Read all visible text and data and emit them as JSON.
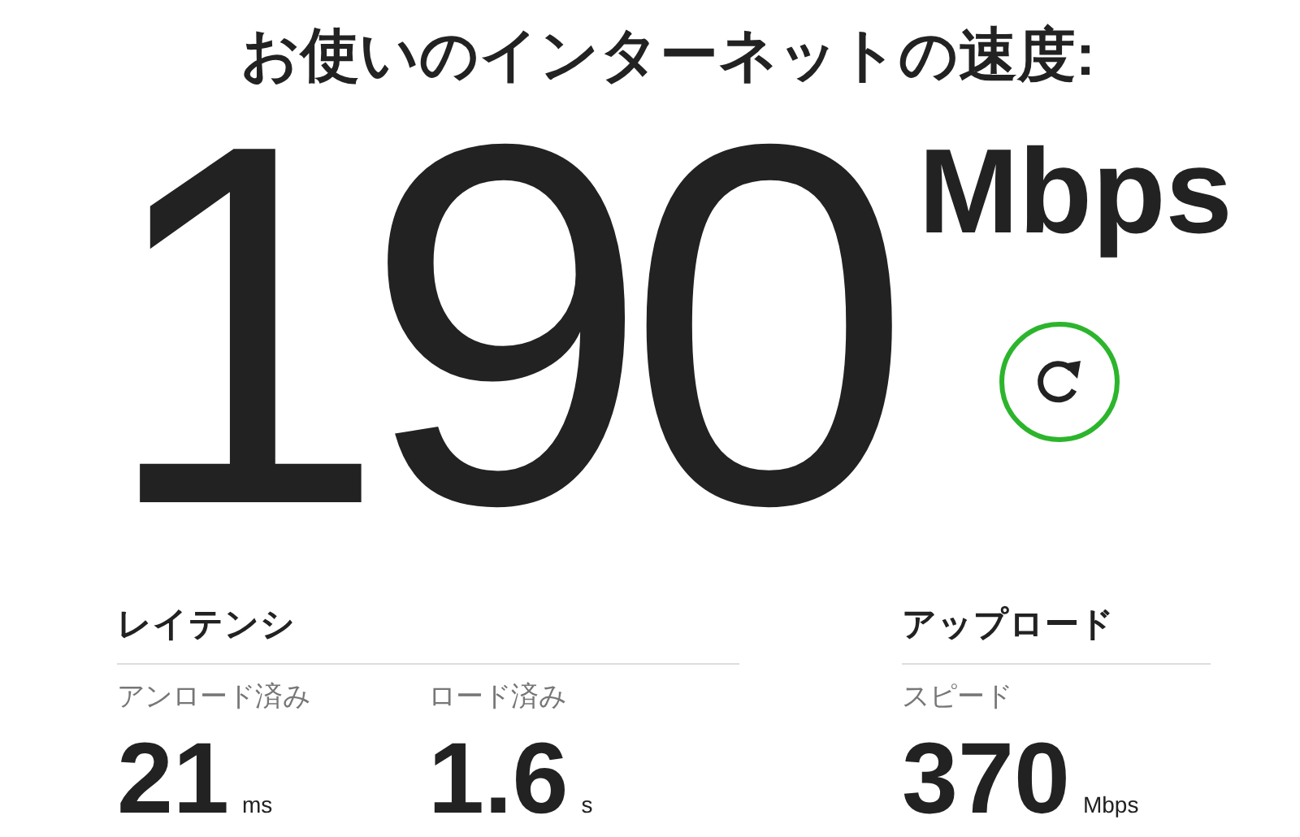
{
  "title": "お使いのインターネットの速度:",
  "speed": {
    "value": "190",
    "unit": "Mbps"
  },
  "sections": [
    {
      "heading": "レイテンシ",
      "metrics": [
        {
          "label": "アンロード済み",
          "value": "21",
          "unit": "ms"
        },
        {
          "label": "ロード済み",
          "value": "1.6",
          "unit": "s"
        }
      ]
    },
    {
      "heading": "アップロード",
      "metrics": [
        {
          "label": "スピード",
          "value": "370",
          "unit": "Mbps"
        }
      ]
    }
  ]
}
